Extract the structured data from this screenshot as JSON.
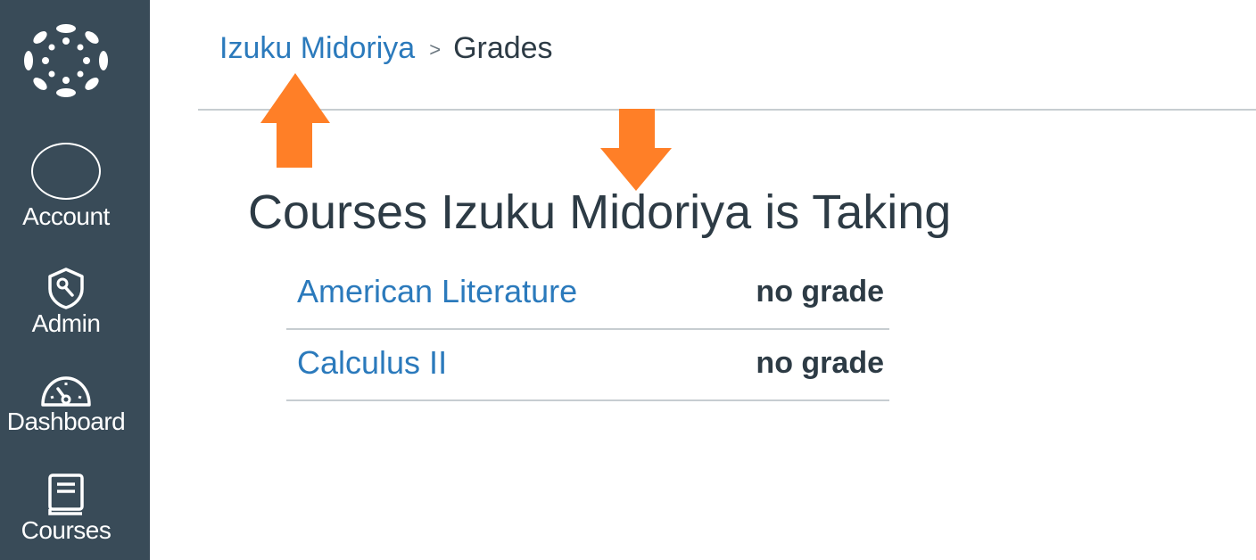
{
  "sidebar": {
    "items": [
      {
        "label": "Account",
        "icon": "avatar-circle-icon"
      },
      {
        "label": "Admin",
        "icon": "admin-shield-icon"
      },
      {
        "label": "Dashboard",
        "icon": "dashboard-gauge-icon"
      },
      {
        "label": "Courses",
        "icon": "courses-book-icon"
      }
    ],
    "logo": "canvas-logo-icon",
    "background": "#394b58"
  },
  "breadcrumb": {
    "link": "Izuku Midoriya",
    "separator": ">",
    "current": "Grades"
  },
  "page_title": "Courses Izuku Midoriya is Taking",
  "courses": [
    {
      "name": "American Literature",
      "grade": "no grade"
    },
    {
      "name": "Calculus II",
      "grade": "no grade"
    }
  ],
  "annotations": {
    "arrows": [
      "arrow-up-icon",
      "arrow-down-icon"
    ],
    "color": "#ff7f27"
  },
  "colors": {
    "link": "#2b7abc",
    "text": "#2d3b45",
    "divider": "#c7cdd1"
  }
}
